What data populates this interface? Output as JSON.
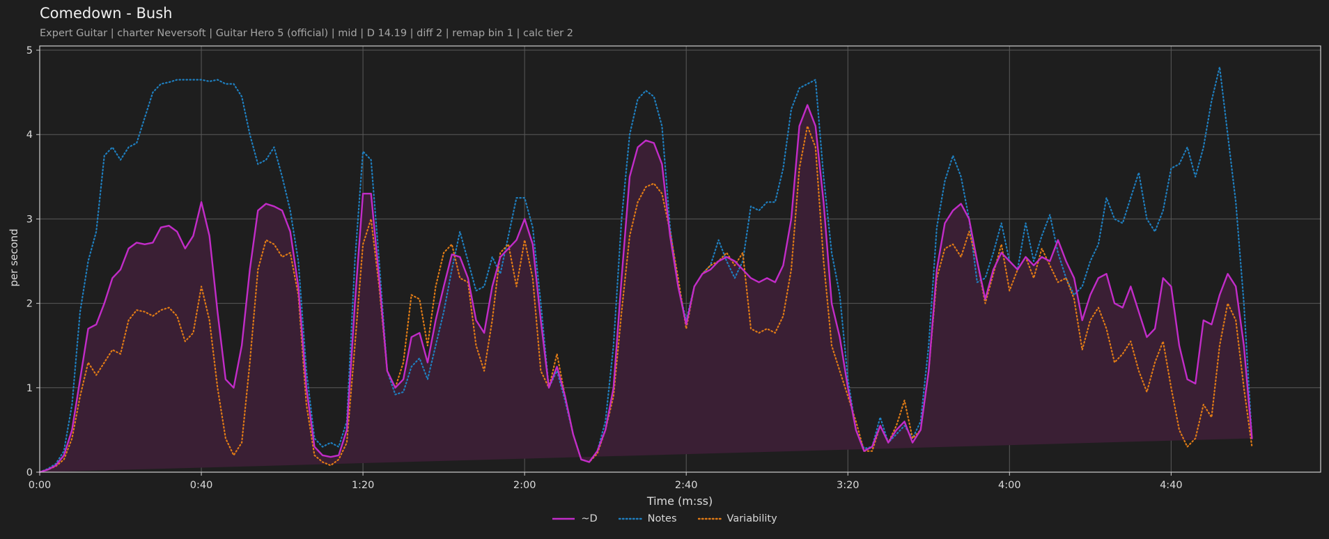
{
  "header": {
    "title": "Comedown - Bush",
    "subtitle": "Expert Guitar  |  charter Neversoft  |  Guitar Hero 5 (official)  |  mid  |  D 14.19  |  diff 2  |  remap bin 1  |  calc tier 2"
  },
  "colors": {
    "background": "#1e1e1e",
    "plot_background": "#1e1e1e",
    "grid": "#5a5a5a",
    "axis": "#cfcfcf",
    "D": "#c22cc8",
    "D_fill": "#3a1f34",
    "notes": "#1f7fbf",
    "variability": "#e07b16"
  },
  "chart_data": {
    "type": "line",
    "title": "Comedown - Bush",
    "subtitle": "Expert Guitar  |  charter Neversoft  |  Guitar Hero 5 (official)  |  mid  |  D 14.19  |  diff 2  |  remap bin 1  |  calc tier 2",
    "xlabel": "Time (m:ss)",
    "ylabel": "per second",
    "xlim": [
      0,
      317
    ],
    "ylim": [
      0,
      5.05
    ],
    "xticks": [
      0,
      40,
      80,
      120,
      160,
      200,
      240,
      280
    ],
    "xtick_labels": [
      "0:00",
      "0:40",
      "1:20",
      "2:00",
      "2:40",
      "3:20",
      "4:00",
      "4:40"
    ],
    "yticks": [
      0,
      1,
      2,
      3,
      4,
      5
    ],
    "ytick_labels": [
      "0",
      "1",
      "2",
      "3",
      "4",
      "5"
    ],
    "grid": true,
    "legend_position": "bottom-center",
    "x": [
      0,
      2,
      4,
      6,
      8,
      10,
      12,
      14,
      16,
      18,
      20,
      22,
      24,
      26,
      28,
      30,
      32,
      34,
      36,
      38,
      40,
      42,
      44,
      46,
      48,
      50,
      52,
      54,
      56,
      58,
      60,
      62,
      64,
      66,
      68,
      70,
      72,
      74,
      76,
      78,
      80,
      82,
      84,
      86,
      88,
      90,
      92,
      94,
      96,
      98,
      100,
      102,
      104,
      106,
      108,
      110,
      112,
      114,
      116,
      118,
      120,
      122,
      124,
      126,
      128,
      130,
      132,
      134,
      136,
      138,
      140,
      142,
      144,
      146,
      148,
      150,
      152,
      154,
      156,
      158,
      160,
      162,
      164,
      166,
      168,
      170,
      172,
      174,
      176,
      178,
      180,
      182,
      184,
      186,
      188,
      190,
      192,
      194,
      196,
      198,
      200,
      202,
      204,
      206,
      208,
      210,
      212,
      214,
      216,
      218,
      220,
      222,
      224,
      226,
      228,
      230,
      232,
      234,
      236,
      238,
      240,
      242,
      244,
      246,
      248,
      250,
      252,
      254,
      256,
      258,
      260,
      262,
      264,
      266,
      268,
      270,
      272,
      274,
      276,
      278,
      280,
      282,
      284,
      286,
      288,
      290,
      292,
      294,
      296,
      298,
      300,
      302,
      304,
      306,
      308,
      310,
      312,
      314,
      316,
      317
    ],
    "series": [
      {
        "name": "~D",
        "style": "solid",
        "values": [
          0,
          0.03,
          0.08,
          0.2,
          0.5,
          1.1,
          1.7,
          1.75,
          2.0,
          2.3,
          2.4,
          2.65,
          2.72,
          2.7,
          2.72,
          2.9,
          2.92,
          2.85,
          2.65,
          2.8,
          3.2,
          2.8,
          1.9,
          1.1,
          1.0,
          1.5,
          2.4,
          3.1,
          3.18,
          3.15,
          3.1,
          2.85,
          2.2,
          1.0,
          0.3,
          0.2,
          0.18,
          0.2,
          0.5,
          2.0,
          3.3,
          3.3,
          2.3,
          1.2,
          1.0,
          1.1,
          1.6,
          1.65,
          1.3,
          1.8,
          2.2,
          2.58,
          2.55,
          2.3,
          1.8,
          1.65,
          2.2,
          2.55,
          2.65,
          2.75,
          3.0,
          2.7,
          1.8,
          1.0,
          1.25,
          0.9,
          0.45,
          0.15,
          0.12,
          0.25,
          0.5,
          1.0,
          2.3,
          3.5,
          3.85,
          3.93,
          3.9,
          3.65,
          2.8,
          2.2,
          1.75,
          2.2,
          2.35,
          2.4,
          2.5,
          2.55,
          2.5,
          2.4,
          2.3,
          2.25,
          2.3,
          2.25,
          2.45,
          3.0,
          4.1,
          4.35,
          4.1,
          3.2,
          2.0,
          1.6,
          1.0,
          0.5,
          0.25,
          0.3,
          0.55,
          0.35,
          0.5,
          0.6,
          0.35,
          0.5,
          1.2,
          2.4,
          2.95,
          3.1,
          3.18,
          3.0,
          2.5,
          2.05,
          2.4,
          2.6,
          2.5,
          2.4,
          2.55,
          2.45,
          2.55,
          2.5,
          2.75,
          2.5,
          2.3,
          1.8,
          2.1,
          2.3,
          2.35,
          2.0,
          1.95,
          2.2,
          1.9,
          1.6,
          1.7,
          2.3,
          2.2,
          1.5,
          1.1,
          1.05,
          1.8,
          1.75,
          2.1,
          2.35,
          2.2,
          1.5,
          0.4
        ]
      },
      {
        "name": "Notes",
        "style": "dotted",
        "values": [
          0,
          0.04,
          0.1,
          0.25,
          0.8,
          1.9,
          2.5,
          2.85,
          3.75,
          3.85,
          3.7,
          3.85,
          3.9,
          4.2,
          4.5,
          4.6,
          4.62,
          4.65,
          4.65,
          4.65,
          4.65,
          4.63,
          4.65,
          4.6,
          4.6,
          4.45,
          4.0,
          3.65,
          3.7,
          3.85,
          3.5,
          3.1,
          2.5,
          1.2,
          0.4,
          0.3,
          0.35,
          0.3,
          0.6,
          2.5,
          3.8,
          3.7,
          2.5,
          1.2,
          0.92,
          0.95,
          1.25,
          1.35,
          1.1,
          1.5,
          1.9,
          2.4,
          2.85,
          2.5,
          2.15,
          2.2,
          2.55,
          2.35,
          2.8,
          3.25,
          3.25,
          2.9,
          2.0,
          1.0,
          1.2,
          0.85,
          0.45,
          0.15,
          0.12,
          0.25,
          0.6,
          1.5,
          3.0,
          4.0,
          4.42,
          4.52,
          4.45,
          4.1,
          2.9,
          2.2,
          1.8,
          2.2,
          2.35,
          2.45,
          2.75,
          2.5,
          2.3,
          2.5,
          3.15,
          3.1,
          3.2,
          3.2,
          3.6,
          4.3,
          4.55,
          4.6,
          4.65,
          3.5,
          2.6,
          2.1,
          1.1,
          0.5,
          0.28,
          0.3,
          0.65,
          0.35,
          0.45,
          0.55,
          0.4,
          0.6,
          1.5,
          2.9,
          3.45,
          3.75,
          3.5,
          3.0,
          2.25,
          2.3,
          2.6,
          2.95,
          2.5,
          2.4,
          2.95,
          2.5,
          2.8,
          3.05,
          2.6,
          2.3,
          2.1,
          2.2,
          2.5,
          2.7,
          3.25,
          3.0,
          2.95,
          3.25,
          3.55,
          3.0,
          2.85,
          3.1,
          3.6,
          3.65,
          3.85,
          3.5,
          3.85,
          4.4,
          4.8,
          4.0,
          3.2,
          2.0,
          0.4
        ]
      },
      {
        "name": "Variability",
        "style": "dotted",
        "values": [
          0,
          0.03,
          0.07,
          0.15,
          0.4,
          0.9,
          1.3,
          1.15,
          1.3,
          1.45,
          1.4,
          1.8,
          1.92,
          1.9,
          1.85,
          1.92,
          1.95,
          1.85,
          1.55,
          1.65,
          2.2,
          1.8,
          1.0,
          0.4,
          0.2,
          0.35,
          1.3,
          2.4,
          2.75,
          2.7,
          2.55,
          2.6,
          2.1,
          0.8,
          0.2,
          0.12,
          0.08,
          0.15,
          0.35,
          1.5,
          2.7,
          3.0,
          2.2,
          1.2,
          1.0,
          1.3,
          2.1,
          2.05,
          1.5,
          2.2,
          2.6,
          2.7,
          2.3,
          2.25,
          1.5,
          1.2,
          1.8,
          2.6,
          2.7,
          2.2,
          2.75,
          2.3,
          1.2,
          1.0,
          1.4,
          0.9,
          0.45,
          0.15,
          0.12,
          0.22,
          0.5,
          0.9,
          1.9,
          2.8,
          3.2,
          3.38,
          3.42,
          3.3,
          2.85,
          2.3,
          1.7,
          2.2,
          2.35,
          2.45,
          2.5,
          2.6,
          2.45,
          2.6,
          1.7,
          1.65,
          1.7,
          1.65,
          1.85,
          2.4,
          3.6,
          4.1,
          3.85,
          2.5,
          1.5,
          1.2,
          0.9,
          0.6,
          0.25,
          0.25,
          0.55,
          0.35,
          0.55,
          0.85,
          0.4,
          0.5,
          1.2,
          2.3,
          2.65,
          2.7,
          2.55,
          2.85,
          2.5,
          2.0,
          2.35,
          2.7,
          2.15,
          2.4,
          2.55,
          2.3,
          2.65,
          2.45,
          2.25,
          2.3,
          2.05,
          1.45,
          1.8,
          1.95,
          1.7,
          1.3,
          1.4,
          1.55,
          1.2,
          0.95,
          1.3,
          1.55,
          1.0,
          0.5,
          0.3,
          0.4,
          0.8,
          0.65,
          1.5,
          2.0,
          1.8,
          1.0,
          0.3
        ]
      }
    ]
  }
}
